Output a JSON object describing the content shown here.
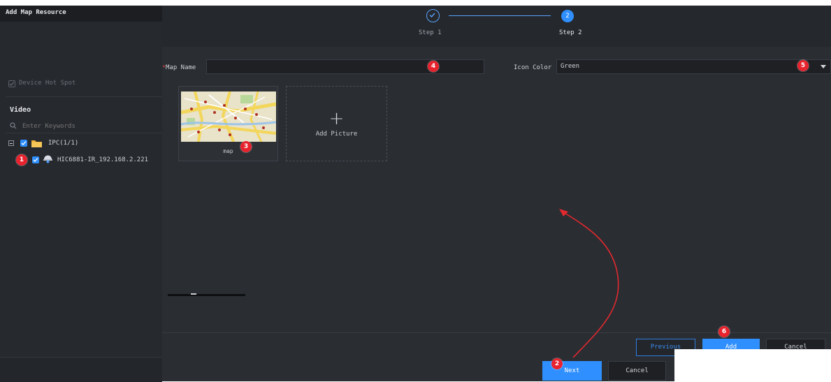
{
  "sidebar": {
    "title": "Add Map Resource",
    "device_hot_spot": "Device Hot Spot",
    "section_title": "Video",
    "search_placeholder": "Enter Keywords",
    "tree": [
      {
        "label": "IPC(1/1)",
        "checked": true
      },
      {
        "label": "HIC6881-IR_192.168.2.221",
        "checked": true
      }
    ]
  },
  "stepper": {
    "step1_label": "Step 1",
    "step2_label": "Step 2",
    "step2_number": "2"
  },
  "form": {
    "map_name_label": "Map Name",
    "map_name_value": "",
    "icon_color_label": "Icon Color",
    "icon_color_value": "Green"
  },
  "tiles": {
    "map_caption": "map",
    "add_picture_label": "Add Picture"
  },
  "buttons": {
    "previous": "Previous",
    "add": "Add",
    "cancel_inner": "Cancel",
    "next": "Next",
    "cancel_outer": "Cancel"
  },
  "badges": [
    "1",
    "2",
    "3",
    "4",
    "5",
    "6"
  ],
  "colors": {
    "accent": "#2f8fff",
    "badge": "#e8232e",
    "annotation_arrow": "#e8232e",
    "background": "#24272c"
  }
}
